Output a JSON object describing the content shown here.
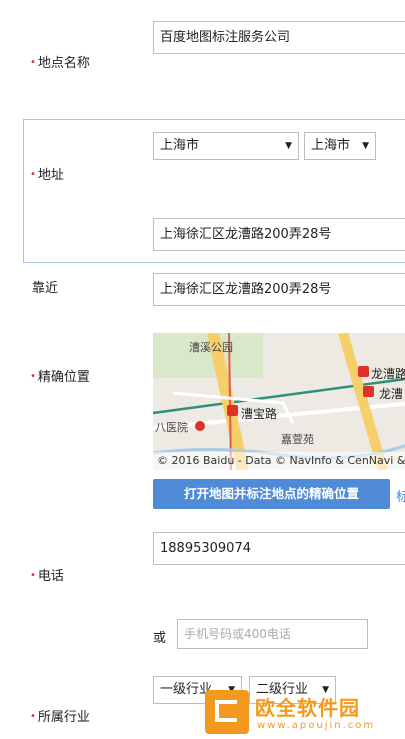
{
  "fields": {
    "place_name": {
      "label": "地点名称",
      "value": "百度地图标注服务公司"
    },
    "address": {
      "label": "地址",
      "province": "上海市",
      "city": "上海市",
      "detail": "上海徐汇区龙漕路200弄28号"
    },
    "nearby": {
      "label": "靠近",
      "value": "上海徐汇区龙漕路200弄28号"
    },
    "precise_location": {
      "label": "精确位置"
    },
    "phone": {
      "label": "电话",
      "value": "18895309074",
      "or_text": "或",
      "alt_placeholder": "手机号码或400电话"
    },
    "industry": {
      "label": "所属行业",
      "level1": "一级行业",
      "level2": "二级行业"
    }
  },
  "required_mark": "•",
  "map": {
    "copyright": "© 2016 Baidu - Data © NavInfo & CenNavi &",
    "labels": [
      "漕溪公园",
      "漕宝路",
      "嘉萱苑",
      "八医院",
      "龙漕路",
      "龙漕"
    ],
    "button_label": "打开地图并标注地点的精确位置",
    "button_suffix": "标"
  },
  "watermark": {
    "name": "欧全软件园",
    "url": "www.apoujin.com"
  },
  "colors": {
    "required": "#e0302a",
    "button": "#4f8bd6",
    "focus_border": "#9fc5e8"
  }
}
